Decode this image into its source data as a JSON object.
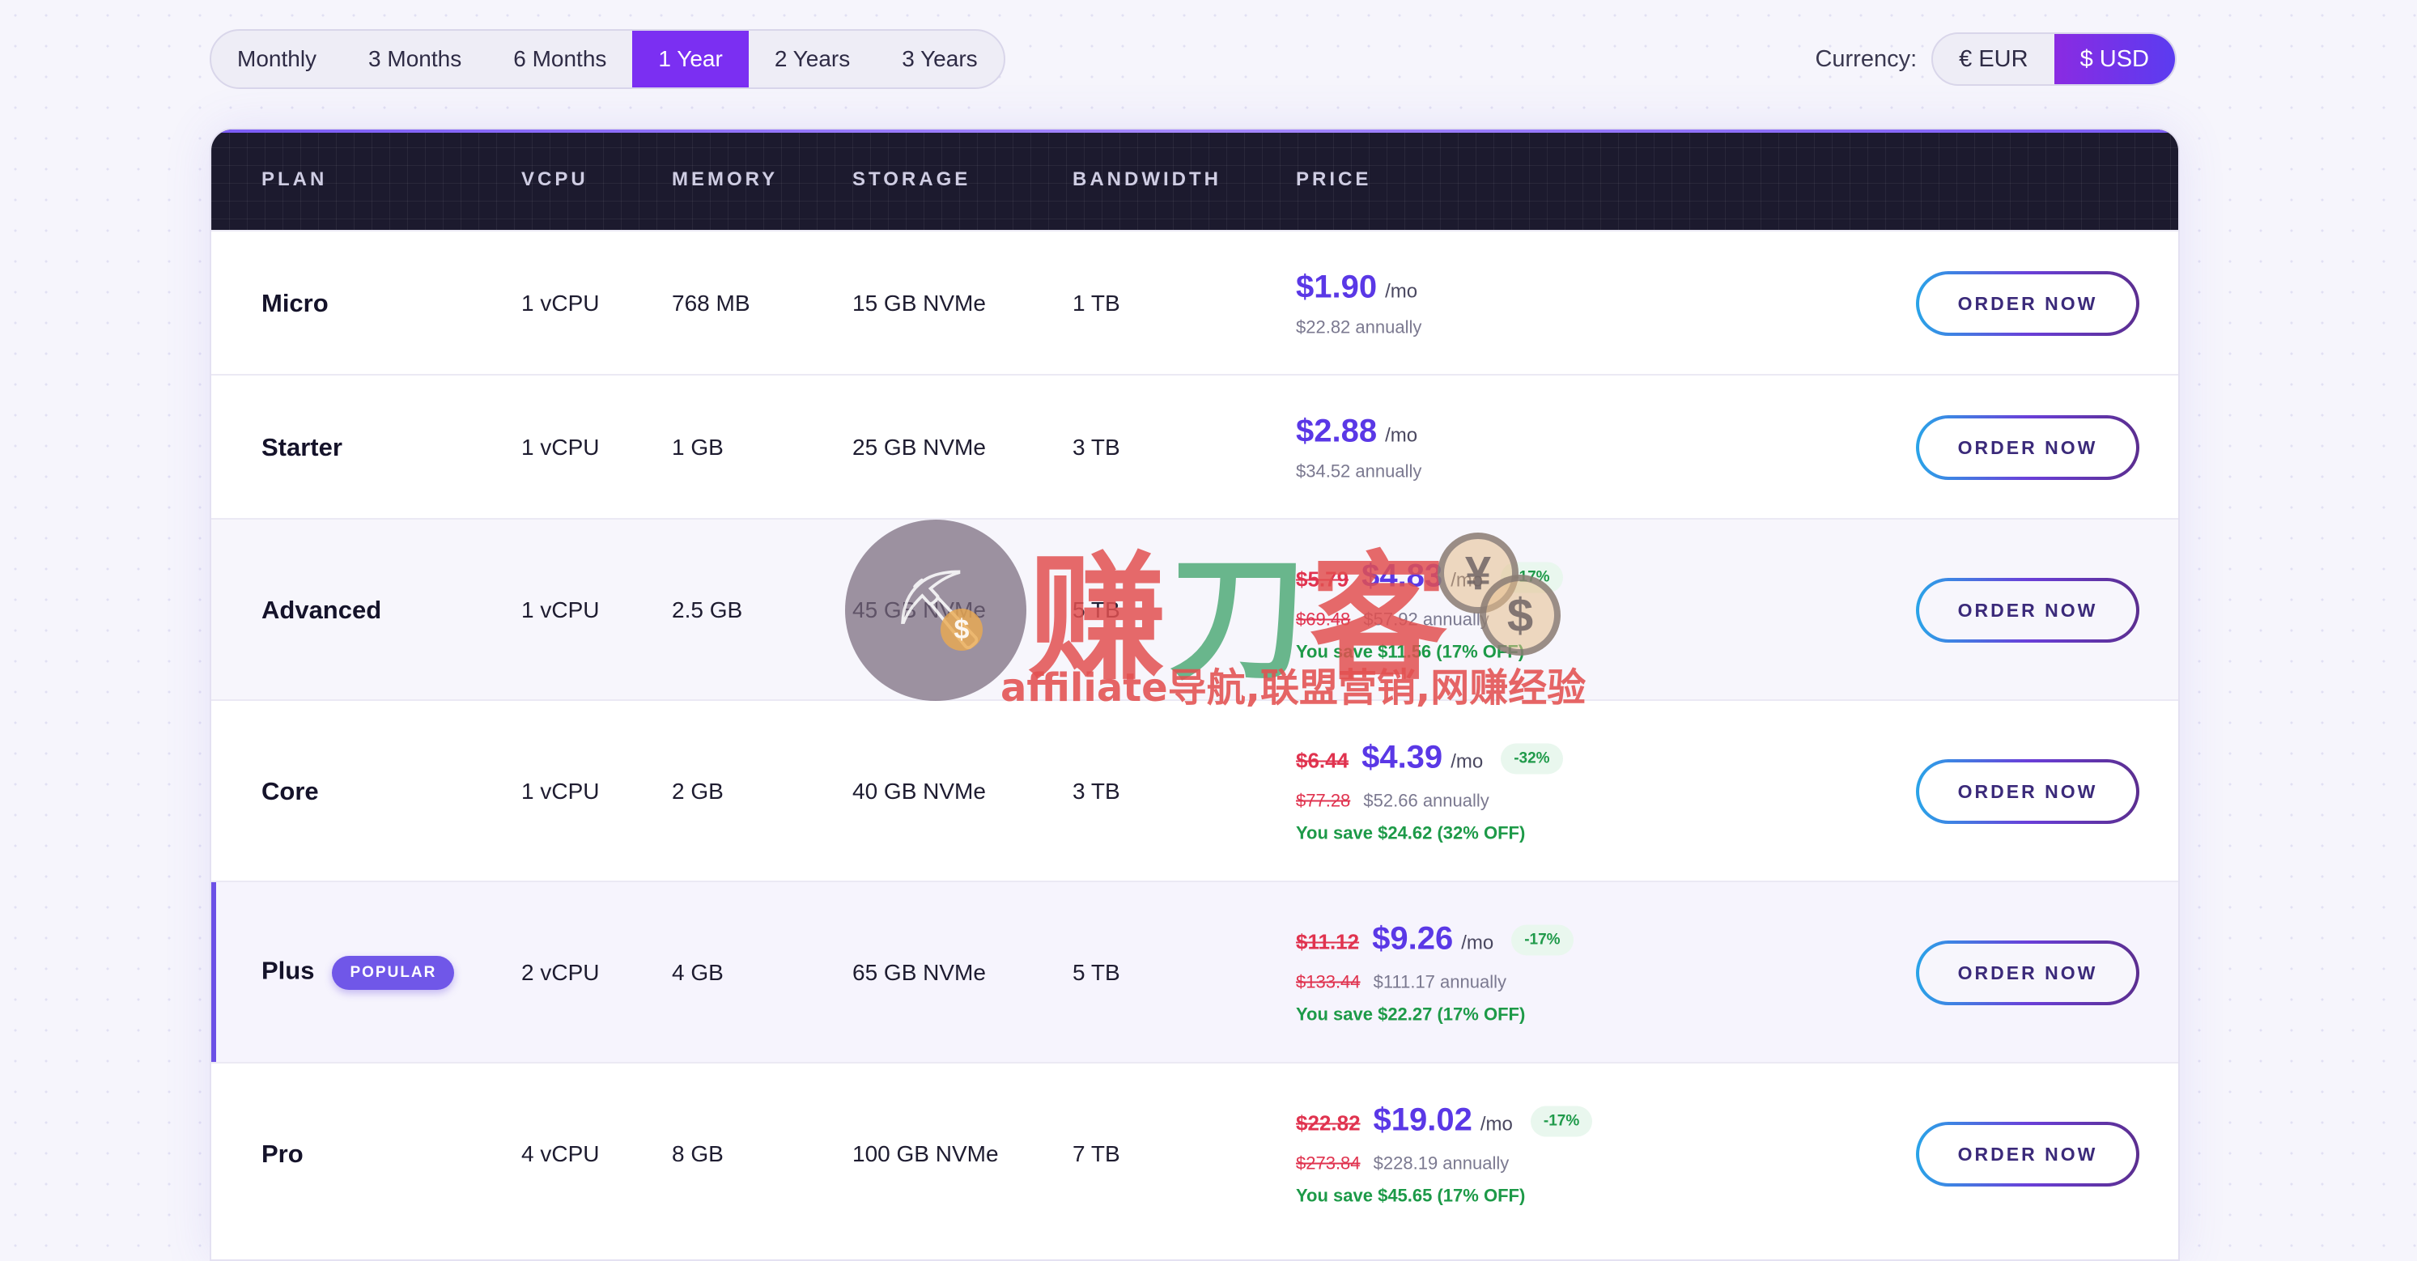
{
  "billing_periods": {
    "options": [
      "Monthly",
      "3 Months",
      "6 Months",
      "1 Year",
      "2 Years",
      "3 Years"
    ],
    "selected": "1 Year"
  },
  "currency": {
    "label": "Currency:",
    "options": [
      "€ EUR",
      "$ USD"
    ],
    "selected": "$ USD"
  },
  "table": {
    "headers": {
      "plan": "PLAN",
      "vcpu": "VCPU",
      "memory": "MEMORY",
      "storage": "STORAGE",
      "bandwidth": "BANDWIDTH",
      "price": "PRICE"
    },
    "per_month_suffix": "/mo",
    "order_label": "ORDER NOW",
    "popular_badge": "POPULAR",
    "rows": [
      {
        "plan": "Micro",
        "vcpu": "1 vCPU",
        "memory": "768 MB",
        "storage": "15 GB NVMe",
        "bandwidth": "1 TB",
        "price": "$1.90",
        "annual": "$22.82 annually"
      },
      {
        "plan": "Starter",
        "vcpu": "1 vCPU",
        "memory": "1 GB",
        "storage": "25 GB NVMe",
        "bandwidth": "3 TB",
        "price": "$2.88",
        "annual": "$34.52 annually"
      },
      {
        "plan": "Advanced",
        "vcpu": "1 vCPU",
        "memory": "2.5 GB",
        "storage": "45 GB NVMe",
        "bandwidth": "5 TB",
        "old_price": "$5.79",
        "price": "$4.83",
        "discount": "-17%",
        "old_annual": "$69.48",
        "annual": "$57.92 annually",
        "savings": "You save $11.56 (17% OFF)"
      },
      {
        "plan": "Core",
        "vcpu": "1 vCPU",
        "memory": "2 GB",
        "storage": "40 GB NVMe",
        "bandwidth": "3 TB",
        "old_price": "$6.44",
        "price": "$4.39",
        "discount": "-32%",
        "old_annual": "$77.28",
        "annual": "$52.66 annually",
        "savings": "You save $24.62 (32% OFF)"
      },
      {
        "plan": "Plus",
        "popular": true,
        "vcpu": "2 vCPU",
        "memory": "4 GB",
        "storage": "65 GB NVMe",
        "bandwidth": "5 TB",
        "old_price": "$11.12",
        "price": "$9.26",
        "discount": "-17%",
        "old_annual": "$133.44",
        "annual": "$111.17 annually",
        "savings": "You save $22.27 (17% OFF)"
      },
      {
        "plan": "Pro",
        "vcpu": "4 vCPU",
        "memory": "8 GB",
        "storage": "100 GB NVMe",
        "bandwidth": "7 TB",
        "old_price": "$22.82",
        "price": "$19.02",
        "discount": "-17%",
        "old_annual": "$273.84",
        "annual": "$228.19 annually",
        "savings": "You save $45.65 (17% OFF)"
      }
    ]
  },
  "watermark": {
    "title_chars": [
      "赚",
      "刀",
      "客"
    ],
    "subtitle": "affiliate导航,联盟营销,网赚经验"
  },
  "colors": {
    "accent": "#7b2ff2",
    "price": "#5a38e6",
    "strike": "#e0334f",
    "savings": "#1d9a48",
    "header_bg": "#1c1a2e"
  }
}
